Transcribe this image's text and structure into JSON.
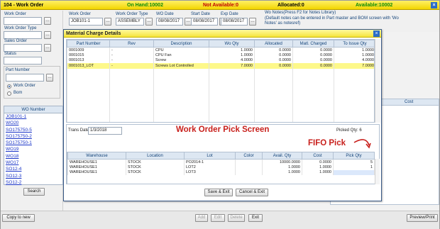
{
  "titlebar": {
    "title": "104 - Work Order",
    "on_hand": "On Hand:10002",
    "not_available": "Not Available:0",
    "allocated": "Allocated:0",
    "available": "Available:10002"
  },
  "left": {
    "work_order_label": "Work Order",
    "work_order_type_label": "Work Order Type",
    "sales_order_label": "Sales Order",
    "status_label": "Status",
    "part_number_label": "Part Number",
    "radio_work_order": "Work Order",
    "radio_bom": "Bom",
    "list_header": "WO Number",
    "list_items": [
      "JOB101-1",
      "WO20",
      "SO175750-5",
      "SO175750-2",
      "SO175750-1",
      "WO19",
      "WO18",
      "WO17",
      "SO12-4",
      "SO12-3",
      "SO12-2"
    ],
    "search_button": "Search"
  },
  "header": {
    "work_order_label": "Work Order",
    "work_order_value": "JOB101-1",
    "type_label": "Work Order Type",
    "type_value": "ASSEMBLY",
    "wo_date_label": "WO Date",
    "wo_date_value": "08/08/2017",
    "start_date_label": "Start Date",
    "start_date_value": "08/08/2017",
    "exp_date_label": "Exp Date",
    "exp_date_value": "08/08/2017",
    "wo_notes": "Wo Notes(Press F2 for Notes Library)",
    "wo_notes_help": "(Default notes can be entered in Part master and BOM screen with 'Wo Notes' as notesref)"
  },
  "bg_table": {
    "cost_header": "Cost"
  },
  "bottom": {
    "copy_to_new": "Copy to new",
    "add": "Add",
    "edit": "Edit",
    "delete": "Delete",
    "exit": "Exit",
    "preview_print": "Preview/Print"
  },
  "modal": {
    "title": "Material Charge Details",
    "columns": [
      "Part Number",
      "Rev",
      "Description",
      "Wo Qty",
      "Allocated",
      "Matl. Charged",
      "To Issue Qty"
    ],
    "rows": [
      [
        "0001009",
        "-",
        "CPU",
        "1.0000",
        "0.0000",
        "0.0000",
        "1.0000"
      ],
      [
        "0001015",
        "-",
        "CPU Fan",
        "1.0000",
        "0.0000",
        "0.0000",
        "1.0000"
      ],
      [
        "0001013",
        "-",
        "Screw",
        "4.0000",
        "0.0000",
        "0.0000",
        "4.0000"
      ],
      [
        "0001013_LOT",
        "-",
        "Screws Lot Controlled",
        "7.0000",
        "0.0000",
        "0.0000",
        "7.0000"
      ]
    ],
    "trans_date_label": "Trans Date:",
    "trans_date_value": "1/3/2018",
    "picked_qty": "Picked Qty: 6",
    "pick_columns": [
      "Warehouse",
      "Location",
      "Lot",
      "Color",
      "Avail. Qty",
      "Cost",
      "Pick Qty"
    ],
    "pick_rows": [
      [
        "WAREHOUSE1",
        "STOCK",
        "PO2014-1",
        "",
        "10000.0000",
        "0.0000",
        "5"
      ],
      [
        "WAREHOUSE1",
        "STOCK",
        "LOT2",
        "",
        "1.0000",
        "1.0000",
        "1"
      ],
      [
        "WAREHOUSE1",
        "STOCK",
        "LOT3",
        "",
        "1.0000",
        "1.0000",
        ""
      ]
    ],
    "save_exit": "Save & Exit",
    "cancel_exit": "Cancel & Exit"
  },
  "annotations": {
    "screen_label": "Work Order Pick Screen",
    "fifo_label": "FIFO Pick",
    "accent_color": "#c8201c"
  }
}
